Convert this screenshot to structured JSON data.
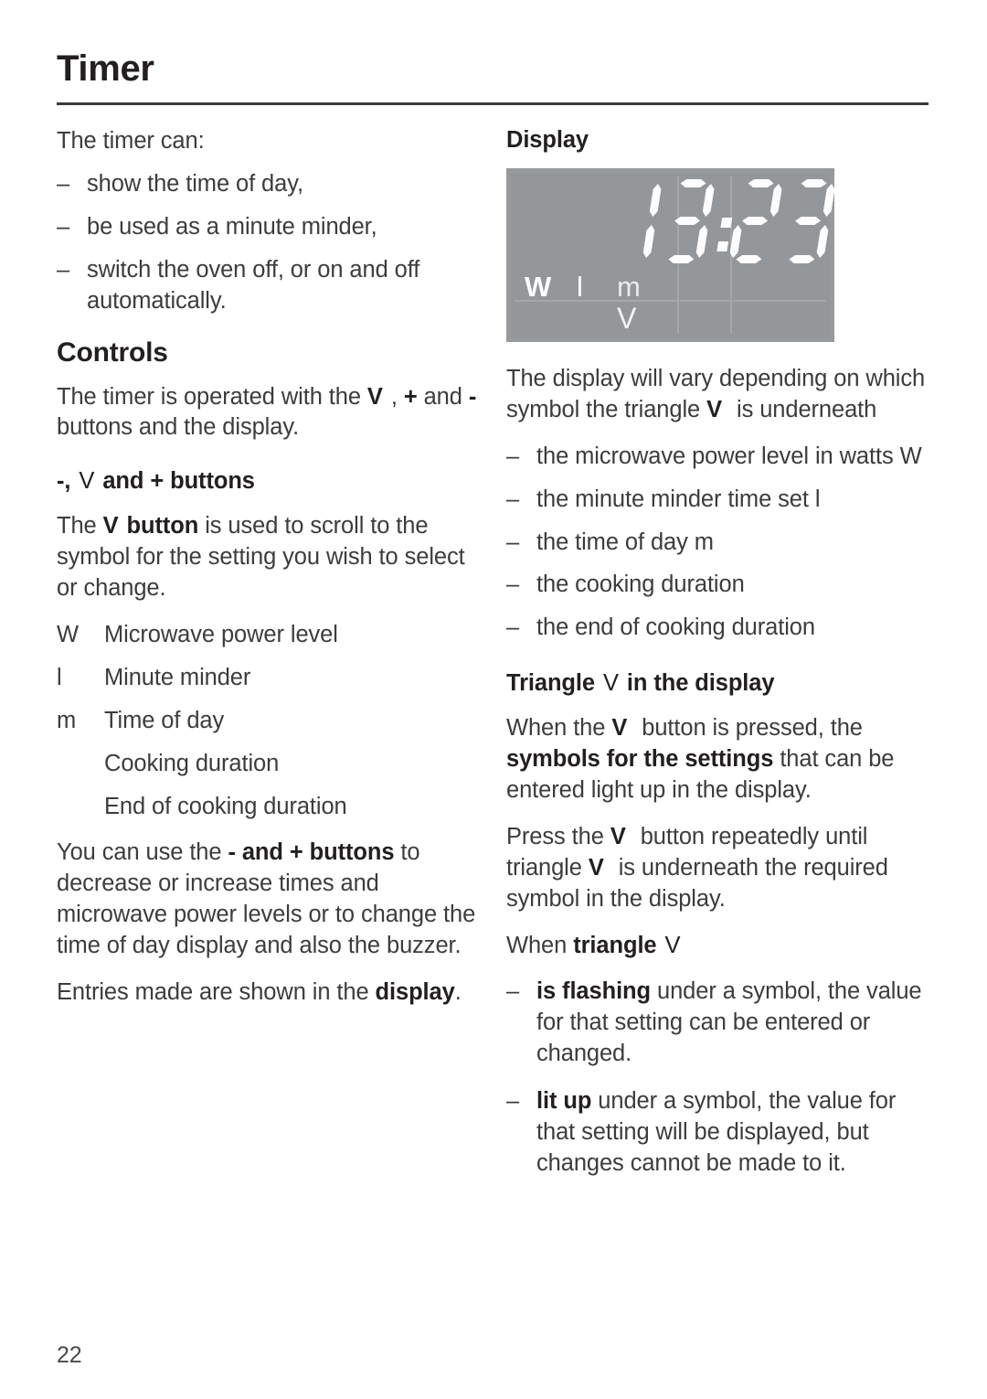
{
  "page": {
    "title": "Timer",
    "number": "22",
    "symbols": {
      "triangle": "V",
      "plus": "+",
      "minus": "-",
      "watts": "W",
      "minute_minder": "l",
      "time_of_day": "m"
    }
  },
  "left_column": {
    "intro_lead": "The timer can:",
    "intro_bullets": [
      "show the time of day,",
      "be used as a minute minder,",
      "switch the oven off, or on and off automatically."
    ],
    "controls_heading": "Controls",
    "controls_para": {
      "part1": "The timer is operated with the ",
      "sym1": "V",
      "part2": ", ",
      "sym2": "+",
      "part3": " and ",
      "sym3": "-",
      "part4": " buttons and the display."
    },
    "buttons_heading": {
      "minus": "-,",
      "triangle": "V",
      "rest": "and + buttons"
    },
    "scroll_para": {
      "part1": "The ",
      "sym": "V",
      "bold": "button",
      "part2": " is used to scroll to the symbol for the setting you wish to select or change."
    },
    "symbol_rows": [
      {
        "symbol": "W",
        "text": "Microwave power level"
      },
      {
        "symbol": "l",
        "text": "Minute minder"
      },
      {
        "symbol": "m",
        "text": "Time of day"
      },
      {
        "symbol": "",
        "text": "Cooking duration"
      },
      {
        "symbol": "",
        "text": "End of cooking duration"
      }
    ],
    "use_para": {
      "part1": "You can use the ",
      "bold": "- and + buttons",
      "part2": " to decrease or increase times and microwave power levels or to change the time of day display and also the buzzer."
    },
    "entries_para": {
      "part1": "Entries made are shown in the ",
      "bold": "display",
      "part2": "."
    }
  },
  "right_column": {
    "display_heading": "Display",
    "lcd": {
      "time": "13:23",
      "digits": [
        "1",
        "3",
        "2",
        "3"
      ],
      "separator": ":",
      "symbols": [
        "W",
        "l",
        "m"
      ],
      "triangle_marker": "V",
      "triangle_under": "m",
      "background_color": "#97999c",
      "segment_color": "#fdfdfd"
    },
    "vary_para": {
      "part1": "The display will vary depending on which symbol the triangle ",
      "sym": "V",
      "part2": " is underneath"
    },
    "vary_bullets": [
      "the microwave power level in watts W",
      "the minute minder time set l",
      "the time of day m",
      "the cooking duration",
      "the end of cooking duration"
    ],
    "triangle_heading": {
      "part1": "Triangle",
      "sym": "V",
      "part2": "in the display"
    },
    "pressed_para": {
      "part1": "When the ",
      "sym": "V",
      "part2": " button is pressed, the ",
      "bold": "symbols for the settings",
      "part3": " that can be entered light up in the display."
    },
    "repeat_para": {
      "part1": "Press the ",
      "sym1": "V",
      "part2": " button repeatedly until triangle ",
      "sym2": "V",
      "part3": " is underneath the required symbol in the display."
    },
    "when_triangle": {
      "part1": "When ",
      "bold": "triangle",
      "sym": "V"
    },
    "state_bullets": [
      {
        "bold": "is flashing",
        "text": " under a symbol, the value for that setting can be entered or changed."
      },
      {
        "bold": "lit up",
        "text": " under a symbol, the value for that setting will be displayed, but changes cannot be made to it."
      }
    ]
  }
}
